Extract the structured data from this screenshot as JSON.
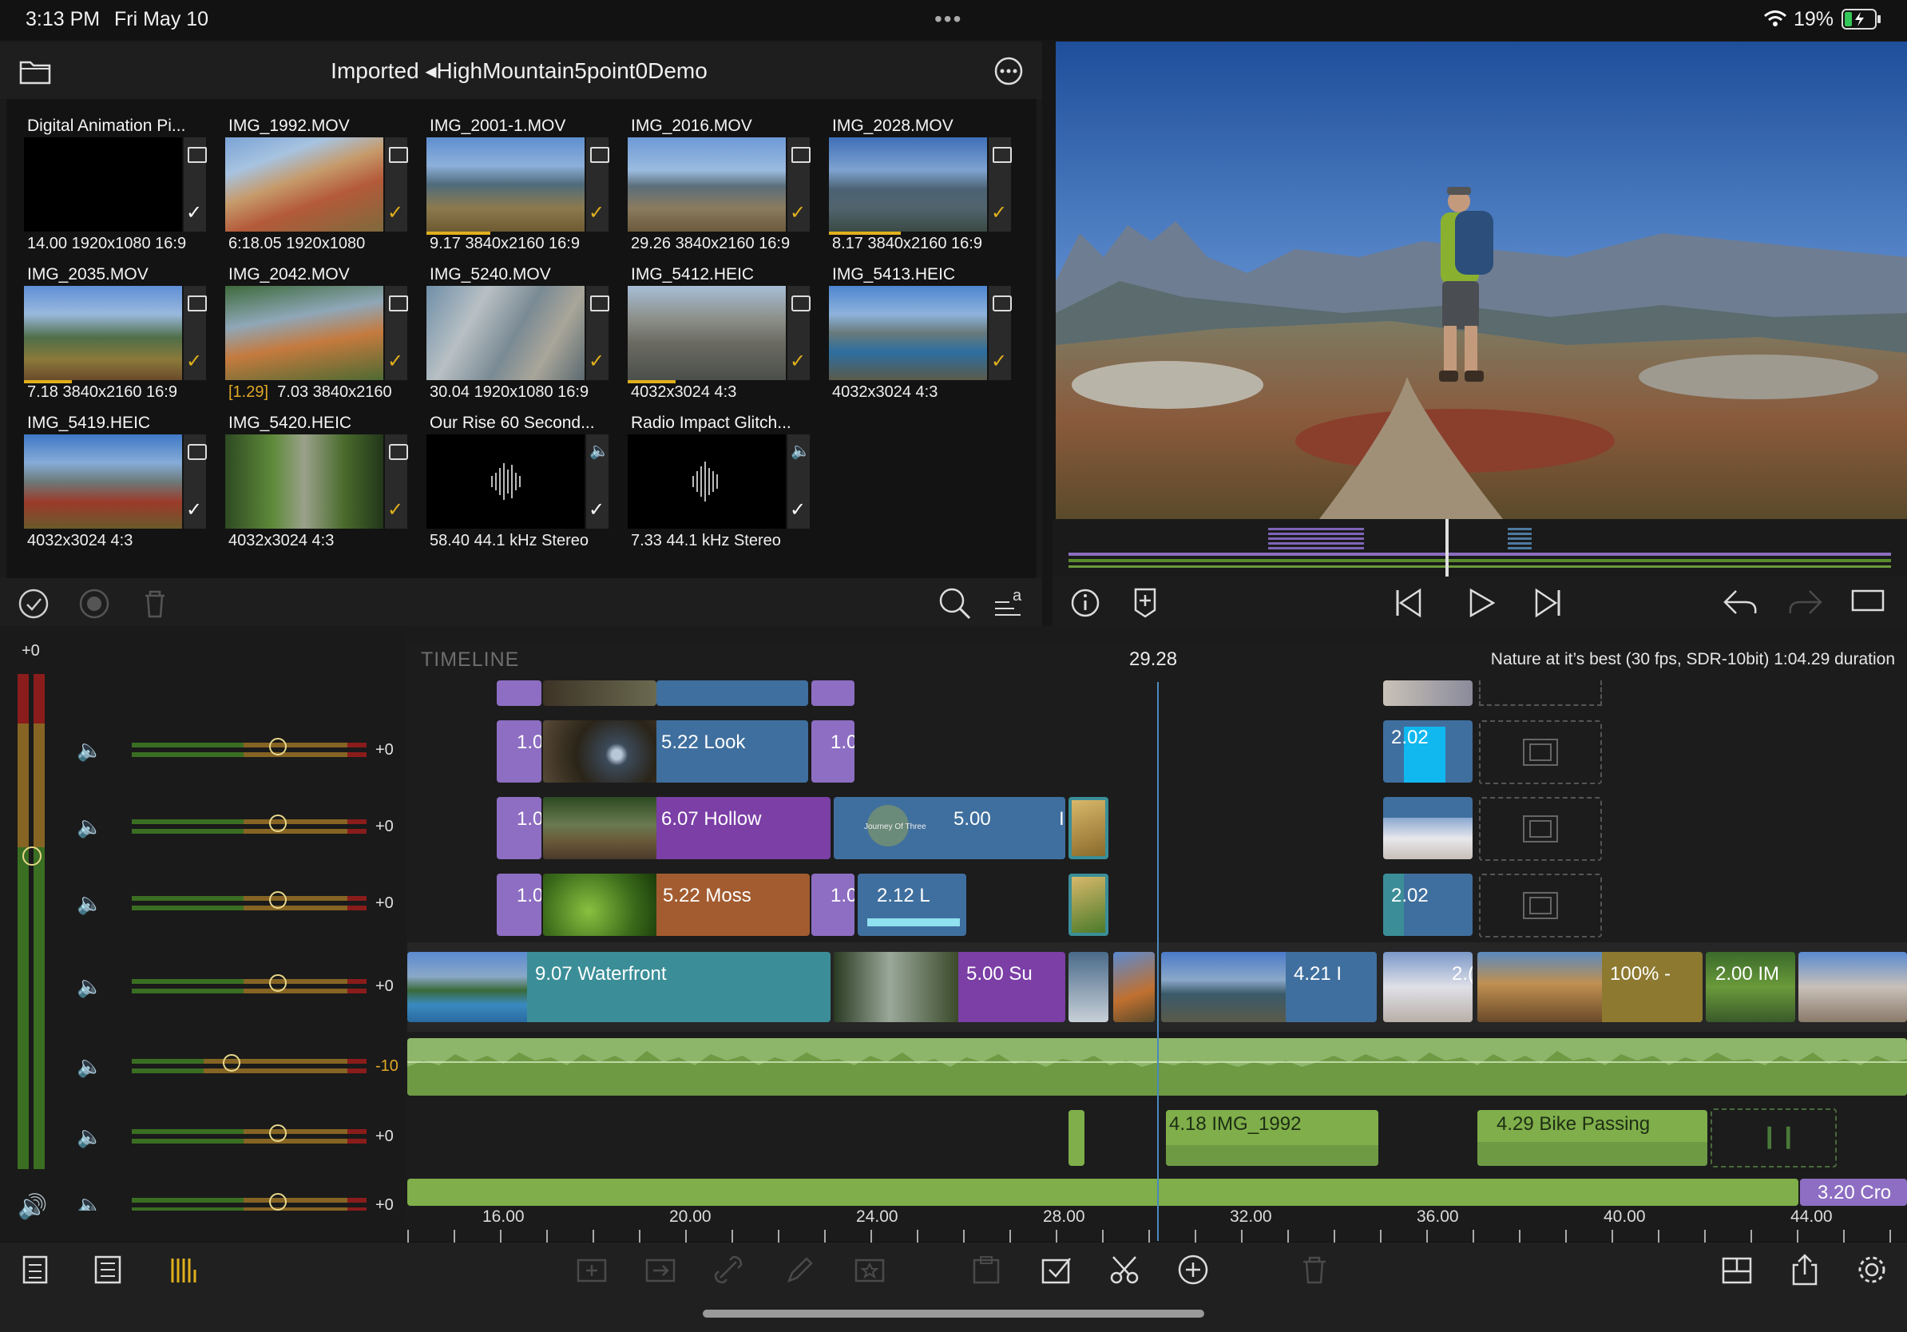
{
  "status_bar": {
    "time": "3:13 PM",
    "date": "Fri May 10",
    "battery": "19%"
  },
  "browser": {
    "breadcrumb": "Imported ◂HighMountain5point0Demo",
    "clips": [
      {
        "name": "Digital Animation Pi...",
        "info": "14.00  1920x1080  16:9"
      },
      {
        "name": "IMG_1992.MOV",
        "info": "6:18.05  1920x1080"
      },
      {
        "name": "IMG_2001-1.MOV",
        "info": "9.17  3840x2160  16:9"
      },
      {
        "name": "IMG_2016.MOV",
        "info": "29.26  3840x2160  16:9"
      },
      {
        "name": "IMG_2028.MOV",
        "info": "8.17  3840x2160  16:9"
      },
      {
        "name": "IMG_2035.MOV",
        "info": "7.18  3840x2160  16:9"
      },
      {
        "name": "IMG_2042.MOV",
        "trim": "[1.29]",
        "info": "7.03  3840x2160"
      },
      {
        "name": "IMG_5240.MOV",
        "info": "30.04  1920x1080  16:9"
      },
      {
        "name": "IMG_5412.HEIC",
        "info": "4032x3024  4:3"
      },
      {
        "name": "IMG_5413.HEIC",
        "info": "4032x3024  4:3"
      },
      {
        "name": "IMG_5419.HEIC",
        "info": "4032x3024  4:3"
      },
      {
        "name": "IMG_5420.HEIC",
        "info": "4032x3024  4:3"
      },
      {
        "name": "Our Rise 60 Second...",
        "info": "58.40  44.1 kHz  Stereo"
      },
      {
        "name": "Radio Impact Glitch...",
        "info": "7.33  44.1 kHz  Stereo"
      }
    ]
  },
  "timeline": {
    "title": "TIMELINE",
    "playhead_time": "29.28",
    "project": "Nature at it’s best (30 fps, SDR-10bit)  1:04.29 duration",
    "master_level": "+0",
    "mixer_values": [
      "+0",
      "+0",
      "+0",
      "+0",
      "-10",
      "+0",
      "+0"
    ],
    "ruler": [
      "16.00",
      "20.00",
      "24.00",
      "28.00",
      "32.00",
      "36.00",
      "40.00",
      "44.00"
    ],
    "clips": {
      "r1a": "1.0",
      "r1b": "5.22  Look",
      "r1c": "1.0",
      "r1d": "2.02",
      "r2a": "1.0",
      "r2b": "6.07  Hollow",
      "r2c": "5.00",
      "r2d": "I",
      "r3a": "1.0",
      "r3b": "5.22  Moss",
      "r3c": "1.0",
      "r3d": "2.12  L",
      "r3e": "2.02",
      "m1": "9.07  Waterfront",
      "m2": "5.00  Su",
      "m3": "4.21  I",
      "m4": "2.(",
      "m5": "100% -",
      "m6": "2.00  IM",
      "a1": "4.18  IMG_1992",
      "a2": "4.29  Bike Passing",
      "a3": "3.20  Cro",
      "thumb_text": "Journey Of Three"
    }
  },
  "colors": {
    "purple": "#8d6ec2",
    "blue": "#3f6f9e",
    "teal": "#3b8e98",
    "violet": "#7b3fa6",
    "orange": "#a35c30",
    "olive": "#8d7a30",
    "green_audio": "#7fae4a",
    "accent_yellow": "#e0b01c"
  }
}
